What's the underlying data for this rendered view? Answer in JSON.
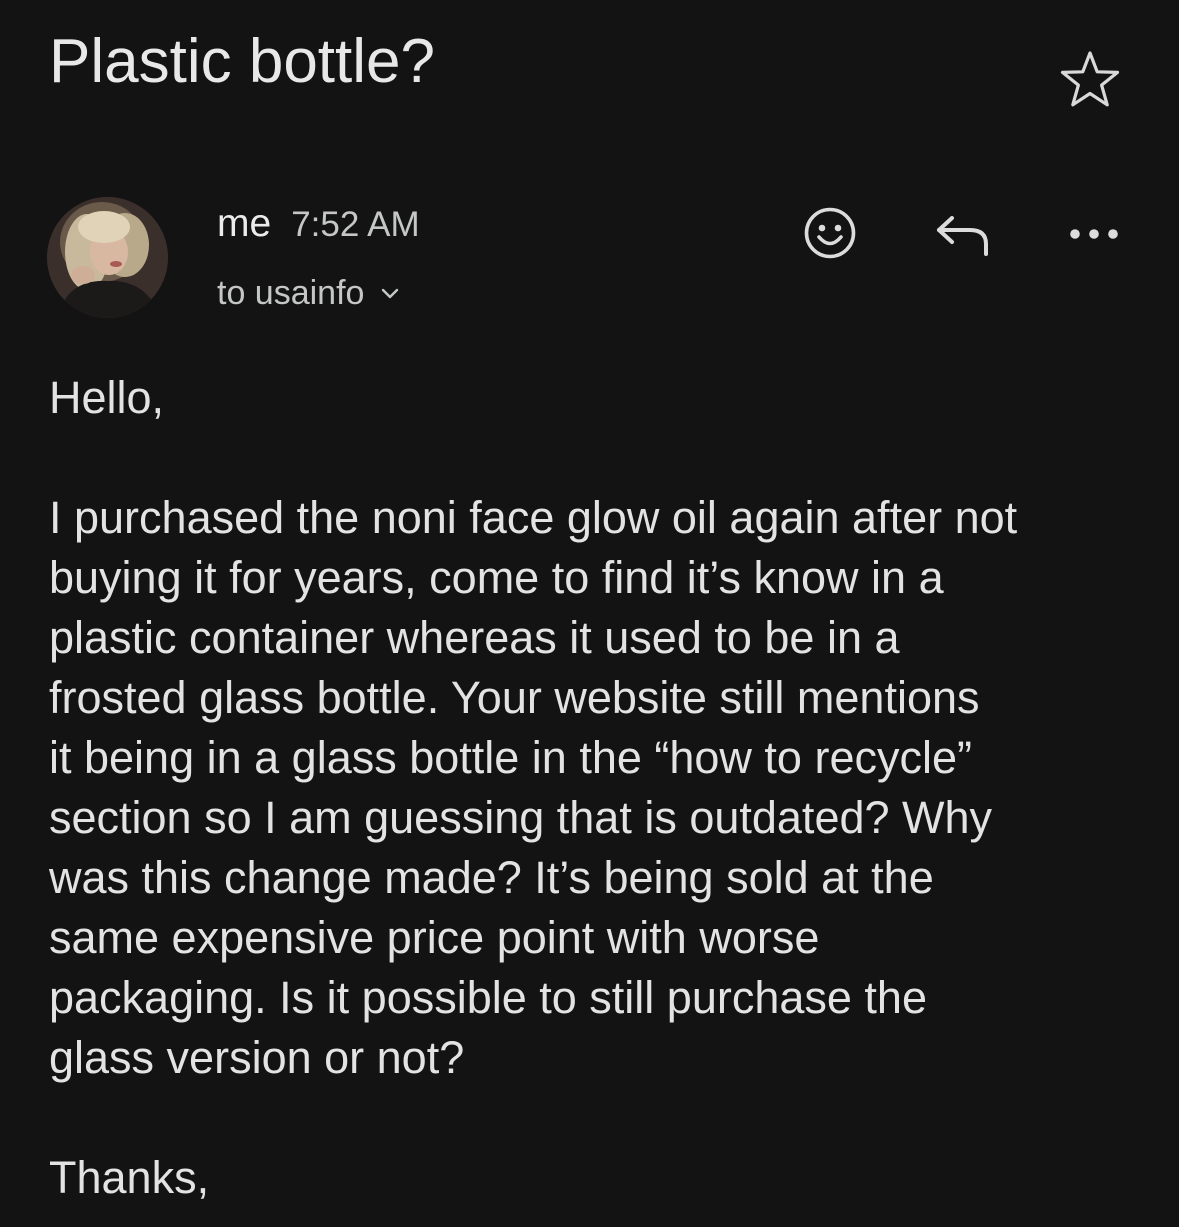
{
  "email": {
    "subject": "Plastic bottle?",
    "sender": "me",
    "time": "7:52 AM",
    "recipient": "to usainfo",
    "greeting": "Hello,",
    "body_lines": [
      "I purchased the noni face glow oil again after not",
      "buying it for years, come to find it’s know in a",
      "plastic container whereas it used to be in a",
      "frosted glass bottle. Your website still mentions",
      "it being in a glass bottle in the “how to recycle”",
      "section so I am guessing that is outdated? Why",
      "was this change made? It’s being sold at the",
      "same expensive price point with worse",
      "packaging. Is it possible to still purchase the",
      "glass version or not?"
    ],
    "closing": "Thanks,"
  },
  "icons": {
    "star": "star-icon",
    "emoji": "emoji-icon",
    "reply": "reply-icon",
    "more": "more-icon",
    "chevron": "chevron-down-icon"
  },
  "colors": {
    "background": "#131314",
    "text": "#e3e3e3",
    "secondary_text": "#c4c7c5"
  }
}
